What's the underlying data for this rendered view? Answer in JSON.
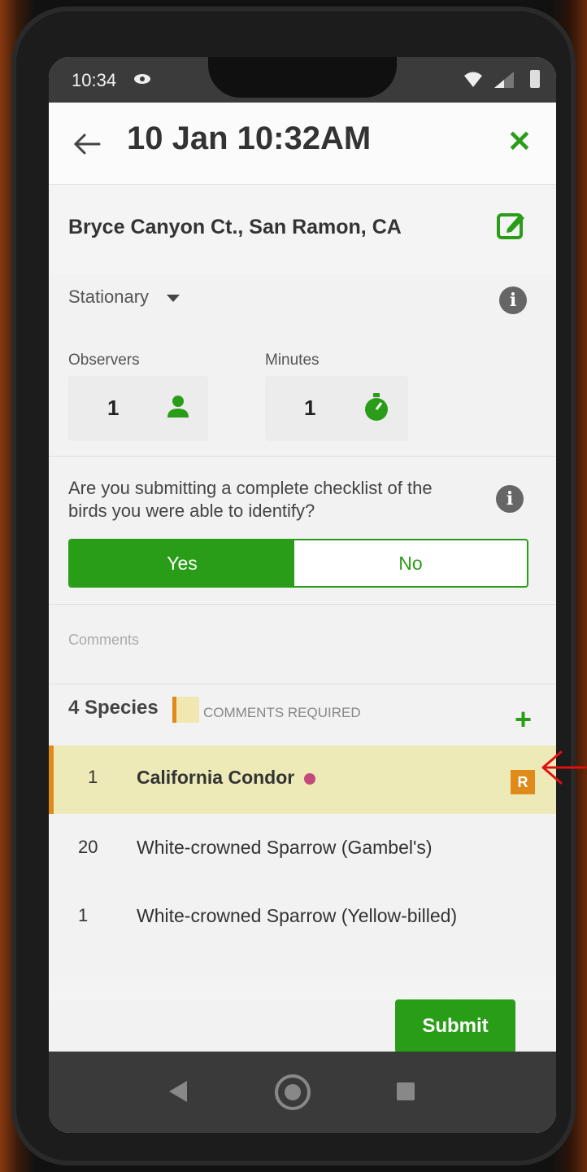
{
  "status_bar": {
    "time": "10:34"
  },
  "header": {
    "title": "10 Jan 10:32AM"
  },
  "location": {
    "name": "Bryce Canyon Ct., San Ramon, CA"
  },
  "protocol": {
    "selected": "Stationary"
  },
  "observers": {
    "label": "Observers",
    "value": "1"
  },
  "minutes": {
    "label": "Minutes",
    "value": "1"
  },
  "complete_checklist": {
    "question": "Are you submitting a complete checklist of the birds you were able to identify?",
    "yes_label": "Yes",
    "no_label": "No",
    "selected": "Yes"
  },
  "comments": {
    "placeholder": "Comments"
  },
  "species_section": {
    "count_label": "4 Species",
    "legend_label": "COMMENTS REQUIRED"
  },
  "species": [
    {
      "count": "1",
      "name": "California Condor",
      "rare_badge": "R"
    },
    {
      "count": "20",
      "name": "White-crowned Sparrow (Gambel's)"
    },
    {
      "count": "1",
      "name": "White-crowned Sparrow (Yellow-billed)"
    }
  ],
  "actions": {
    "submit_label": "Submit"
  },
  "colors": {
    "accent": "#2a9d18",
    "flag": "#e08a1a",
    "flag_bg": "#eeeab8",
    "annotation": "#e01010"
  }
}
